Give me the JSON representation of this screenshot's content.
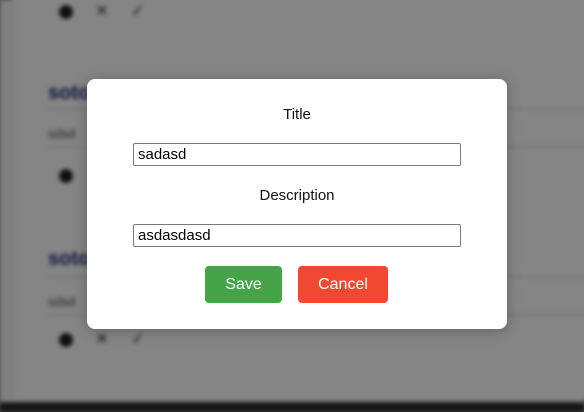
{
  "background": {
    "items": [
      {
        "title": "",
        "description": ""
      },
      {
        "title": "soto",
        "description": "sdsd"
      },
      {
        "title": "soto",
        "description": "sdsd"
      }
    ],
    "icons": [
      "pencil-icon",
      "close-icon",
      "check-icon"
    ]
  },
  "modal": {
    "title_label": "Title",
    "title_value": "sadasd",
    "description_label": "Description",
    "description_value": "asdasdasd",
    "save_label": "Save",
    "cancel_label": "Cancel"
  },
  "colors": {
    "save": "#44a447",
    "cancel": "#f14832",
    "accent": "#1e2a78"
  }
}
